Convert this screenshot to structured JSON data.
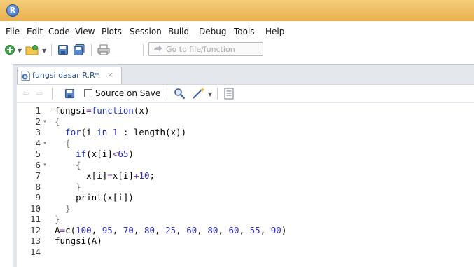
{
  "menu": [
    "File",
    "Edit",
    "Code",
    "View",
    "Plots",
    "Session",
    "Build",
    "Debug",
    "Tools",
    "Help"
  ],
  "toolbar": {
    "goto_placeholder": "Go to file/function"
  },
  "tab": {
    "label": "fungsi dasar R.R*",
    "close": "×"
  },
  "editor_toolbar": {
    "source_on_save": "Source on Save"
  },
  "lines": [
    {
      "num": "1",
      "fold": "",
      "indent": 0,
      "tokens": [
        [
          "t",
          "fungsi"
        ],
        [
          "o",
          "="
        ],
        [
          "k",
          "function"
        ],
        [
          "t",
          "(x)"
        ]
      ]
    },
    {
      "num": "2",
      "fold": "▾",
      "indent": 0,
      "tokens": [
        [
          "b",
          "{"
        ]
      ]
    },
    {
      "num": "3",
      "fold": "",
      "indent": 1,
      "tokens": [
        [
          "k",
          "for"
        ],
        [
          "t",
          "(i "
        ],
        [
          "k",
          "in"
        ],
        [
          "t",
          " "
        ],
        [
          "n",
          "1"
        ],
        [
          "t",
          " : length(x))"
        ]
      ]
    },
    {
      "num": "4",
      "fold": "▾",
      "indent": 1,
      "tokens": [
        [
          "b",
          "{"
        ]
      ]
    },
    {
      "num": "5",
      "fold": "",
      "indent": 2,
      "tokens": [
        [
          "k",
          "if"
        ],
        [
          "t",
          "(x[i]"
        ],
        [
          "o",
          "<"
        ],
        [
          "n",
          "65"
        ],
        [
          "t",
          ")"
        ]
      ]
    },
    {
      "num": "6",
      "fold": "▾",
      "indent": 2,
      "tokens": [
        [
          "b",
          "{"
        ]
      ]
    },
    {
      "num": "7",
      "fold": "",
      "indent": 3,
      "tokens": [
        [
          "t",
          "x[i]"
        ],
        [
          "o",
          "="
        ],
        [
          "t",
          "x[i]"
        ],
        [
          "o",
          "+"
        ],
        [
          "n",
          "10"
        ],
        [
          "t",
          ";"
        ]
      ]
    },
    {
      "num": "8",
      "fold": "",
      "indent": 2,
      "tokens": [
        [
          "b",
          "}"
        ]
      ]
    },
    {
      "num": "9",
      "fold": "",
      "indent": 2,
      "tokens": [
        [
          "t",
          "print(x[i])"
        ]
      ]
    },
    {
      "num": "10",
      "fold": "",
      "indent": 1,
      "tokens": [
        [
          "b",
          "}"
        ]
      ]
    },
    {
      "num": "11",
      "fold": "",
      "indent": 0,
      "tokens": [
        [
          "b",
          "}"
        ]
      ]
    },
    {
      "num": "12",
      "fold": "",
      "indent": 0,
      "tokens": [
        [
          "t",
          "A"
        ],
        [
          "o",
          "="
        ],
        [
          "t",
          "c("
        ],
        [
          "n",
          "100"
        ],
        [
          "t",
          ", "
        ],
        [
          "n",
          "95"
        ],
        [
          "t",
          ", "
        ],
        [
          "n",
          "70"
        ],
        [
          "t",
          ", "
        ],
        [
          "n",
          "80"
        ],
        [
          "t",
          ", "
        ],
        [
          "n",
          "25"
        ],
        [
          "t",
          ", "
        ],
        [
          "n",
          "60"
        ],
        [
          "t",
          ", "
        ],
        [
          "n",
          "80"
        ],
        [
          "t",
          ", "
        ],
        [
          "n",
          "60"
        ],
        [
          "t",
          ", "
        ],
        [
          "n",
          "55"
        ],
        [
          "t",
          ", "
        ],
        [
          "n",
          "90"
        ],
        [
          "t",
          ")"
        ]
      ]
    },
    {
      "num": "13",
      "fold": "",
      "indent": 0,
      "tokens": [
        [
          "t",
          "fungsi(A)"
        ]
      ]
    },
    {
      "num": "14",
      "fold": "",
      "indent": 0,
      "tokens": []
    }
  ],
  "icons": {
    "app": "rstudio-logo-icon",
    "toolbar": [
      "new-file-icon",
      "open-project-icon",
      "save-icon",
      "save-all-icon",
      "print-icon",
      "go-to-arrow-icon"
    ],
    "editor_toolbar": [
      "back-arrow-icon",
      "forward-arrow-icon",
      "save-icon",
      "search-icon",
      "magic-wand-icon",
      "compile-report-icon"
    ]
  },
  "colors": {
    "titlebar": "#eab04f",
    "keyword": "#1a35c8",
    "number": "#2d2dc8",
    "operator": "#7b38bb",
    "tab_label": "#234f93"
  }
}
